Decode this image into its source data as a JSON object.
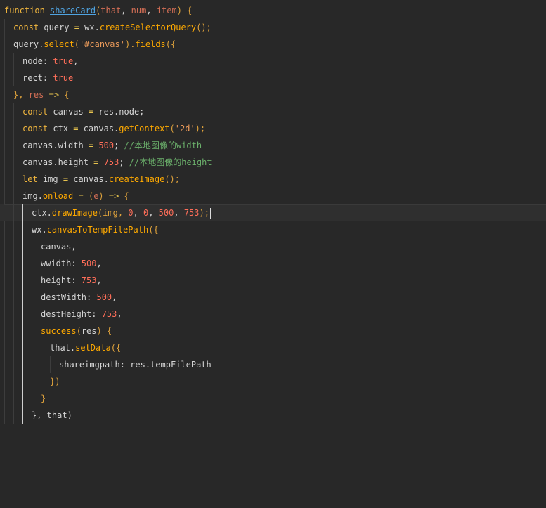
{
  "editor": {
    "lines": [
      {
        "tokens": [
          {
            "t": "function",
            "c": "kw"
          },
          {
            "t": " ",
            "c": "id"
          },
          {
            "t": "shareCard",
            "c": "fnu"
          },
          {
            "t": "(",
            "c": "pn"
          },
          {
            "t": "that",
            "c": "par"
          },
          {
            "t": ", ",
            "c": "id"
          },
          {
            "t": "num",
            "c": "par"
          },
          {
            "t": ", ",
            "c": "id"
          },
          {
            "t": "item",
            "c": "par"
          },
          {
            "t": ") {",
            "c": "pn"
          }
        ]
      },
      {
        "tokens": [
          {
            "t": "const",
            "c": "kw"
          },
          {
            "t": " query ",
            "c": "id"
          },
          {
            "t": "=",
            "c": "op"
          },
          {
            "t": " wx.",
            "c": "id"
          },
          {
            "t": "createSelectorQuery",
            "c": "fn"
          },
          {
            "t": "();",
            "c": "pn"
          }
        ]
      },
      {
        "tokens": [
          {
            "t": "query.",
            "c": "id"
          },
          {
            "t": "select",
            "c": "fn"
          },
          {
            "t": "(",
            "c": "pn"
          },
          {
            "t": "'#canvas'",
            "c": "str"
          },
          {
            "t": ").",
            "c": "pn"
          },
          {
            "t": "fields",
            "c": "fn"
          },
          {
            "t": "({",
            "c": "pn"
          }
        ]
      },
      {
        "tokens": [
          {
            "t": "node: ",
            "c": "id"
          },
          {
            "t": "true",
            "c": "bool"
          },
          {
            "t": ",",
            "c": "id"
          }
        ]
      },
      {
        "tokens": [
          {
            "t": "rect: ",
            "c": "id"
          },
          {
            "t": "true",
            "c": "bool"
          }
        ]
      },
      {
        "tokens": [
          {
            "t": "}, ",
            "c": "pn"
          },
          {
            "t": "res",
            "c": "par"
          },
          {
            "t": " ",
            "c": "id"
          },
          {
            "t": "=>",
            "c": "op"
          },
          {
            "t": " {",
            "c": "pn"
          }
        ]
      },
      {
        "tokens": [
          {
            "t": "const",
            "c": "kw"
          },
          {
            "t": " canvas ",
            "c": "id"
          },
          {
            "t": "=",
            "c": "op"
          },
          {
            "t": " res.node;",
            "c": "id"
          }
        ]
      },
      {
        "tokens": [
          {
            "t": "const",
            "c": "kw"
          },
          {
            "t": " ctx ",
            "c": "id"
          },
          {
            "t": "=",
            "c": "op"
          },
          {
            "t": " canvas.",
            "c": "id"
          },
          {
            "t": "getContext",
            "c": "fn"
          },
          {
            "t": "(",
            "c": "pn"
          },
          {
            "t": "'2d'",
            "c": "str"
          },
          {
            "t": ");",
            "c": "pn"
          }
        ]
      },
      {
        "tokens": [
          {
            "t": "canvas.width ",
            "c": "id"
          },
          {
            "t": "=",
            "c": "op"
          },
          {
            "t": " ",
            "c": "id"
          },
          {
            "t": "500",
            "c": "num"
          },
          {
            "t": "; ",
            "c": "id"
          },
          {
            "t": "//本地图像的width",
            "c": "com"
          }
        ]
      },
      {
        "tokens": [
          {
            "t": "canvas.height ",
            "c": "id"
          },
          {
            "t": "=",
            "c": "op"
          },
          {
            "t": " ",
            "c": "id"
          },
          {
            "t": "753",
            "c": "num"
          },
          {
            "t": "; ",
            "c": "id"
          },
          {
            "t": "//本地图像的height",
            "c": "com"
          }
        ]
      },
      {
        "tokens": [
          {
            "t": "let",
            "c": "kw"
          },
          {
            "t": " img ",
            "c": "id"
          },
          {
            "t": "=",
            "c": "op"
          },
          {
            "t": " canvas.",
            "c": "id"
          },
          {
            "t": "createImage",
            "c": "fn"
          },
          {
            "t": "();",
            "c": "pn"
          }
        ]
      },
      {
        "tokens": [
          {
            "t": "img.",
            "c": "id"
          },
          {
            "t": "onload",
            "c": "fn"
          },
          {
            "t": " ",
            "c": "id"
          },
          {
            "t": "=",
            "c": "op"
          },
          {
            "t": " (",
            "c": "pn"
          },
          {
            "t": "e",
            "c": "par"
          },
          {
            "t": ") ",
            "c": "pn"
          },
          {
            "t": "=>",
            "c": "op"
          },
          {
            "t": " {",
            "c": "pn"
          }
        ]
      },
      {
        "tokens": [
          {
            "t": "ctx.",
            "c": "id"
          },
          {
            "t": "drawImage",
            "c": "fn"
          },
          {
            "t": "(img, ",
            "c": "pn"
          },
          {
            "t": "0",
            "c": "num"
          },
          {
            "t": ", ",
            "c": "id"
          },
          {
            "t": "0",
            "c": "num"
          },
          {
            "t": ", ",
            "c": "id"
          },
          {
            "t": "500",
            "c": "num"
          },
          {
            "t": ", ",
            "c": "id"
          },
          {
            "t": "753",
            "c": "num"
          },
          {
            "t": ");",
            "c": "pn"
          }
        ]
      },
      {
        "tokens": [
          {
            "t": "wx.",
            "c": "id"
          },
          {
            "t": "canvasToTempFilePath",
            "c": "fn"
          },
          {
            "t": "({",
            "c": "pn"
          }
        ]
      },
      {
        "tokens": [
          {
            "t": "canvas,",
            "c": "id"
          }
        ]
      },
      {
        "tokens": [
          {
            "t": "wwidth: ",
            "c": "id"
          },
          {
            "t": "500",
            "c": "num"
          },
          {
            "t": ",",
            "c": "id"
          }
        ]
      },
      {
        "tokens": [
          {
            "t": "height: ",
            "c": "id"
          },
          {
            "t": "753",
            "c": "num"
          },
          {
            "t": ",",
            "c": "id"
          }
        ]
      },
      {
        "tokens": [
          {
            "t": "destWidth: ",
            "c": "id"
          },
          {
            "t": "500",
            "c": "num"
          },
          {
            "t": ",",
            "c": "id"
          }
        ]
      },
      {
        "tokens": [
          {
            "t": "destHeight: ",
            "c": "id"
          },
          {
            "t": "753",
            "c": "num"
          },
          {
            "t": ",",
            "c": "id"
          }
        ]
      },
      {
        "tokens": [
          {
            "t": "success",
            "c": "fn"
          },
          {
            "t": "(",
            "c": "pn"
          },
          {
            "t": "res",
            "c": "id"
          },
          {
            "t": ") {",
            "c": "pn"
          }
        ]
      },
      {
        "tokens": [
          {
            "t": "that.",
            "c": "id"
          },
          {
            "t": "setData",
            "c": "fn"
          },
          {
            "t": "({",
            "c": "pn"
          }
        ]
      },
      {
        "tokens": [
          {
            "t": "shareimgpath: res.tempFilePath",
            "c": "id"
          }
        ]
      },
      {
        "tokens": [
          {
            "t": "})",
            "c": "pn"
          }
        ]
      },
      {
        "tokens": [
          {
            "t": "}",
            "c": "pn"
          }
        ]
      },
      {
        "tokens": [
          {
            "t": "}, that)",
            "c": "id"
          }
        ]
      }
    ]
  }
}
